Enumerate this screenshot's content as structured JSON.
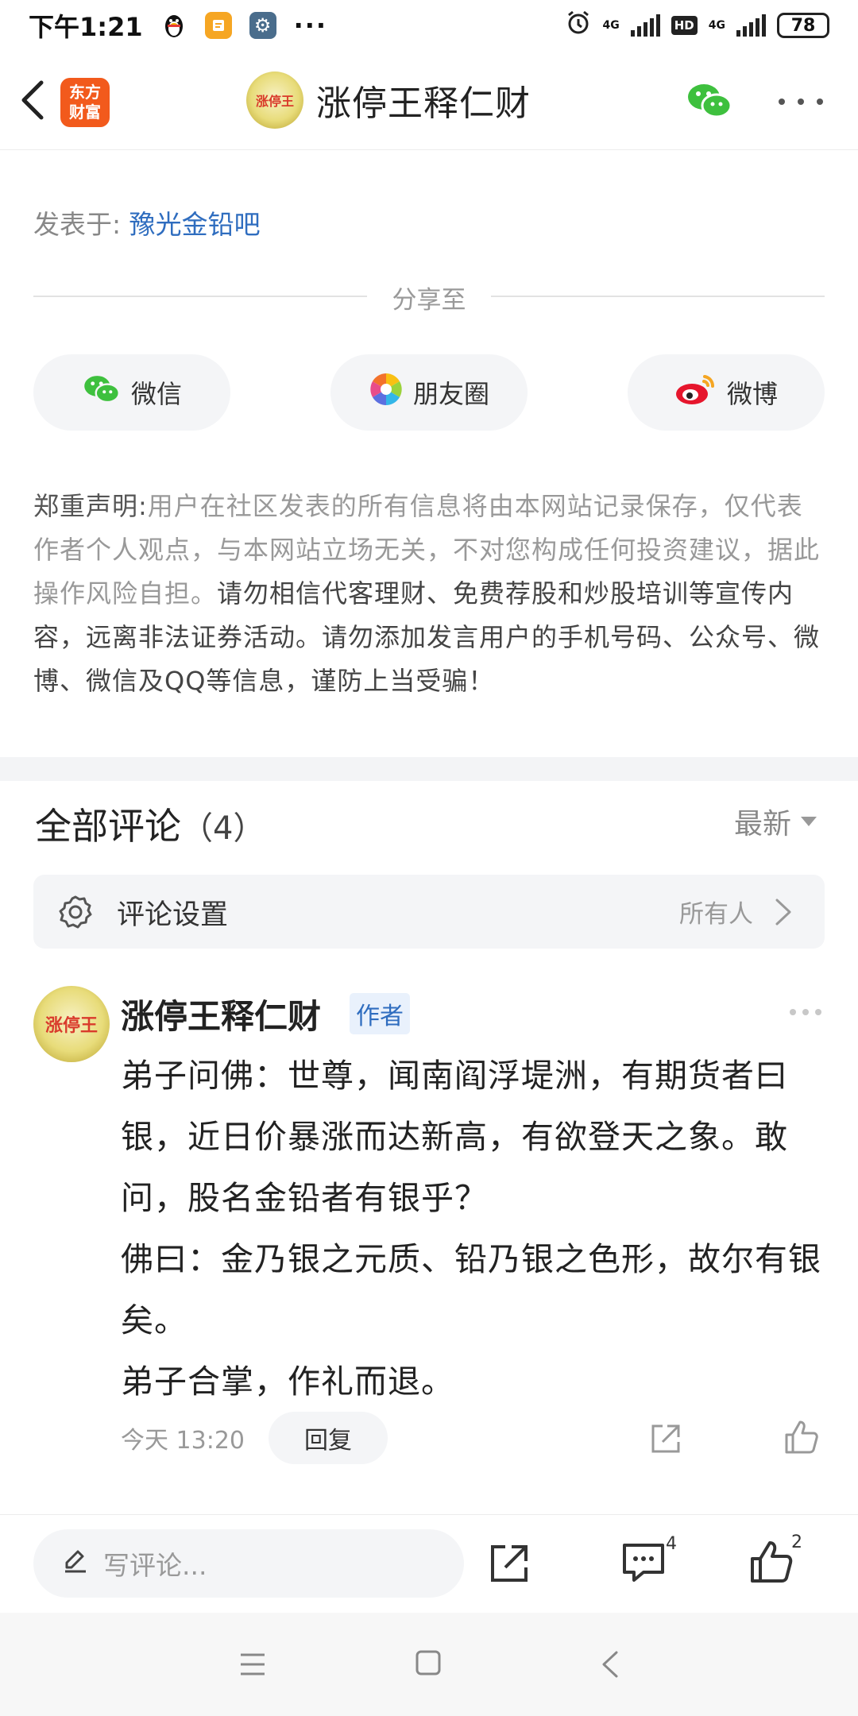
{
  "status_bar": {
    "time": "下午1:21",
    "net1": "4G",
    "net2": "4G",
    "hd": "HD",
    "battery": "78"
  },
  "header": {
    "app_logo_line1": "东方",
    "app_logo_line2": "财富",
    "avatar_text": "涨停王",
    "title": "涨停王释仁财"
  },
  "post": {
    "posted_prefix": "发表于:",
    "forum": "豫光金铅吧"
  },
  "share": {
    "label": "分享至",
    "buttons": [
      "微信",
      "朋友圈",
      "微博"
    ]
  },
  "disclaimer": {
    "head": "郑重声明:",
    "text": "用户在社区发表的所有信息将由本网站记录保存，仅代表作者个人观点，与本网站立场无关，不对您构成任何投资建议，据此操作风险自担。",
    "warning": "请勿相信代客理财、免费荐股和炒股培训等宣传内容，远离非法证券活动。请勿添加发言用户的手机号码、公众号、微博、微信及QQ等信息，谨防上当受骗！"
  },
  "comments": {
    "title": "全部评论",
    "count": "（4）",
    "sort": "最新",
    "settings_label": "评论设置",
    "settings_value": "所有人",
    "items": [
      {
        "avatar_text": "涨停王",
        "author": "涨停王释仁财",
        "badge": "作者",
        "lines": [
          "弟子问佛：世尊，闻南阎浮堤洲，有期货者曰银，近日价暴涨而达新高，有欲登天之象。敢问，股名金铅者有银乎？",
          "佛曰：金乃银之元质、铅乃银之色形，故尔有银矣。",
          "弟子合掌，作礼而退。"
        ],
        "time": "今天 13:20",
        "reply": "回复"
      }
    ]
  },
  "action_bar": {
    "input_placeholder": "写评论...",
    "comment_count": "4",
    "like_count": "2"
  },
  "colors": {
    "link": "#2f6dbf",
    "brand_orange": "#f25a1c",
    "wechat_green": "#3ec03e",
    "weibo_red": "#e6162d"
  }
}
